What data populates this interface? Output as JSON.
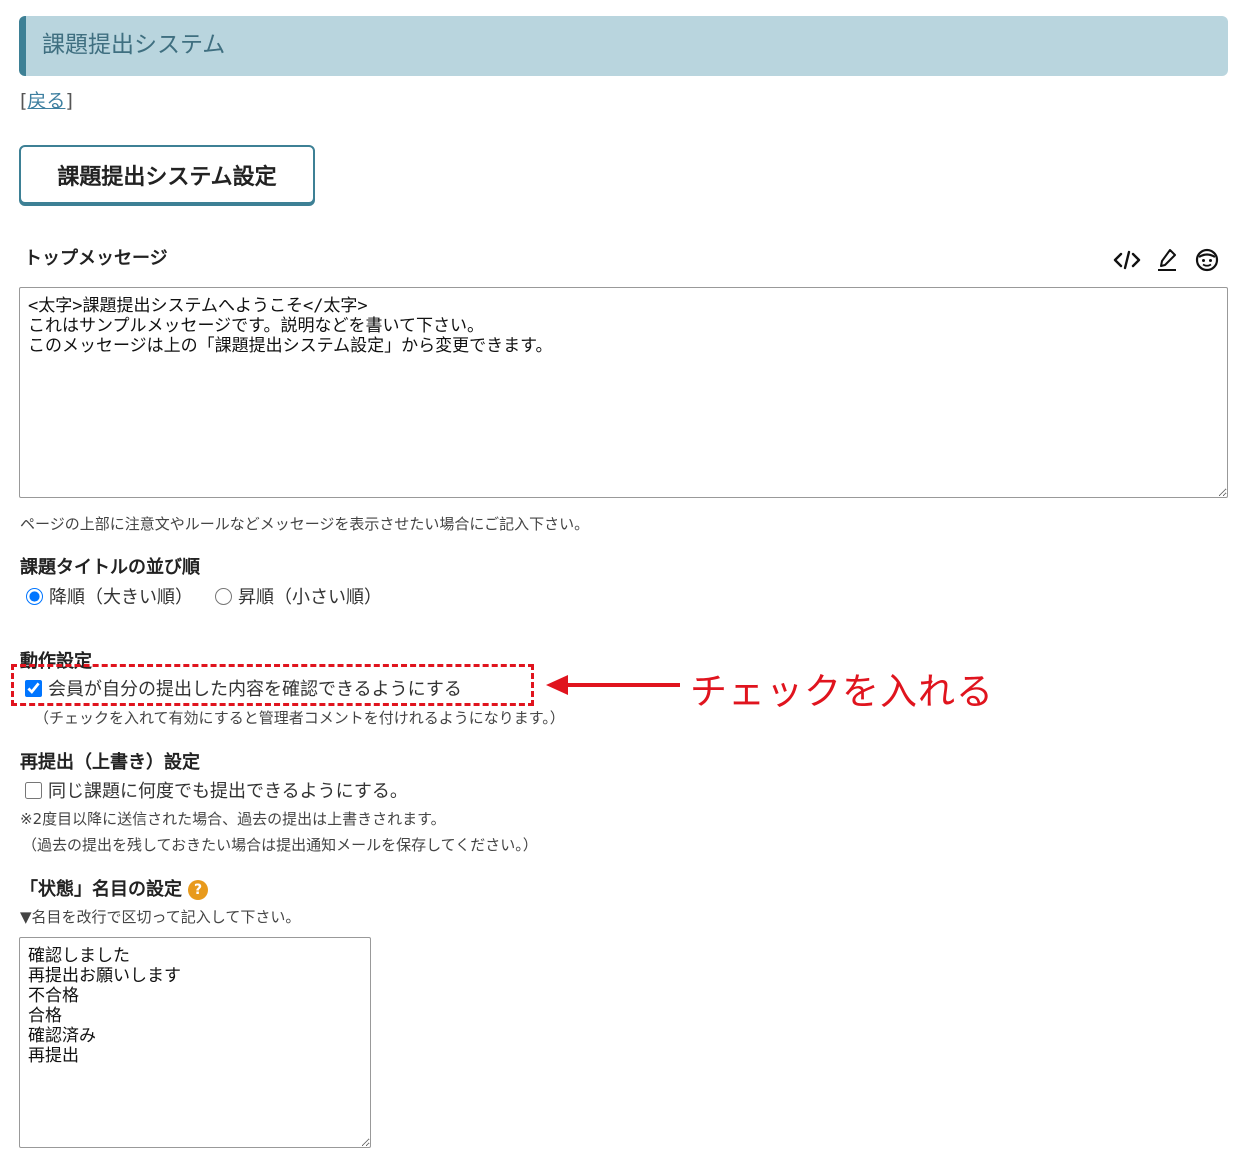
{
  "header": {
    "title": "課題提出システム"
  },
  "nav": {
    "back_open": "[",
    "back_label": "戻る",
    "back_close": "]"
  },
  "settings_button": {
    "label": "課題提出システム設定"
  },
  "top_message": {
    "label": "トップメッセージ",
    "value": "<太字>課題提出システムへようこそ</太字>\nこれはサンプルメッセージです。説明などを書いて下さい。\nこのメッセージは上の「課題提出システム設定」から変更できます。",
    "note": "ページの上部に注意文やルールなどメッセージを表示させたい場合にご記入下さい。",
    "tools": [
      "code-icon",
      "pen-icon",
      "emoji-icon"
    ]
  },
  "sort_order": {
    "label": "課題タイトルの並び順",
    "options": [
      {
        "label": "降順（大きい順）",
        "selected": true
      },
      {
        "label": "昇順（小さい順）",
        "selected": false
      }
    ]
  },
  "behavior": {
    "label": "動作設定",
    "checkbox_label": "会員が自分の提出した内容を確認できるようにする",
    "checked": true,
    "note": "（チェックを入れて有効にすると管理者コメントを付けれるようになります。）"
  },
  "annotation": {
    "text": "チェックを入れる",
    "color": "#e0141e"
  },
  "resubmit": {
    "label": "再提出（上書き）設定",
    "checkbox_label": "同じ課題に何度でも提出できるようにする。",
    "checked": false,
    "note1": "※2度目以降に送信された場合、過去の提出は上書きされます。",
    "note2": "（過去の提出を残しておきたい場合は提出通知メールを保存してください。）"
  },
  "status_names": {
    "label": "「状態」名目の設定",
    "help_icon": "?",
    "instruction": "▼名目を改行で区切って記入して下さい。",
    "value": "確認しました\n再提出お願いします\n不合格\n合格\n確認済み\n再提出"
  },
  "colors": {
    "accent": "#3d8095",
    "header_bg": "#b9d5de",
    "annotation": "#e0141e",
    "help": "#e89a1c"
  }
}
